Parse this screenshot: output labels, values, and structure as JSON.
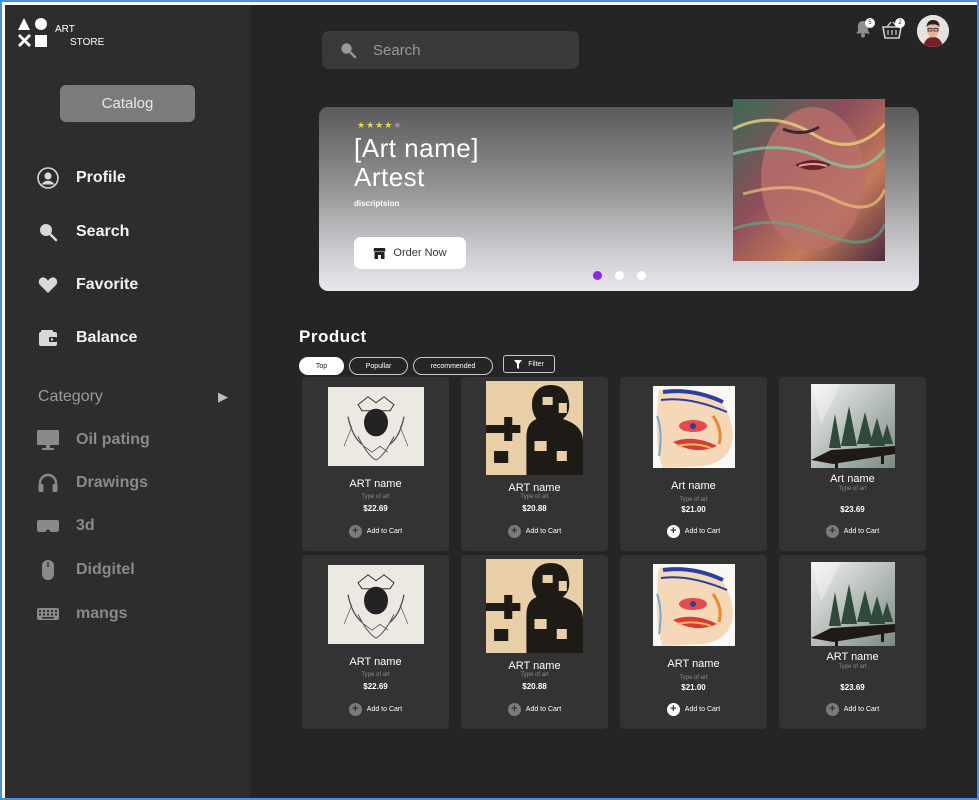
{
  "app": {
    "brand_line1": "ART",
    "brand_line2": "STORE"
  },
  "sidebar": {
    "catalog_label": "Catalog",
    "nav": [
      {
        "label": "Profile",
        "icon": "user-circle-icon"
      },
      {
        "label": "Search",
        "icon": "search-icon"
      },
      {
        "label": "Favorite",
        "icon": "heart-icon"
      },
      {
        "label": "Balance",
        "icon": "wallet-icon"
      }
    ],
    "category_label": "Category",
    "categories": [
      {
        "label": "Oil pating",
        "icon": "monitor-icon"
      },
      {
        "label": "Drawings",
        "icon": "headphones-icon"
      },
      {
        "label": "3d",
        "icon": "vr-goggles-icon"
      },
      {
        "label": "Didgitel",
        "icon": "mouse-icon"
      },
      {
        "label": "mangs",
        "icon": "keyboard-icon"
      }
    ]
  },
  "header": {
    "search_placeholder": "Search",
    "notifications_count": "5",
    "cart_count": "2"
  },
  "hero": {
    "rating": 4,
    "rating_max": 5,
    "title_line1": "[Art name]",
    "title_line2": "Artest",
    "description": "discriptsion",
    "order_label": "Order Now",
    "slides": 3,
    "active_slide": 0
  },
  "products": {
    "title": "Product",
    "filters": [
      "Top",
      "Popullar",
      "recommended"
    ],
    "active_filter": "Top",
    "filter_button": "Filter",
    "add_label": "Add to Cart",
    "items": [
      {
        "name": "ART name",
        "type": "Type of art",
        "price": "$22.69",
        "art": "sketch"
      },
      {
        "name": "ART name",
        "type": "Type of art",
        "price": "$20.88",
        "art": "puzzle"
      },
      {
        "name": "Art name",
        "type": "Type of art",
        "price": "$21.00",
        "art": "face"
      },
      {
        "name": "Art name",
        "type": "Type of art",
        "price": "$23.69",
        "art": "forest"
      },
      {
        "name": "ART name",
        "type": "Type of art",
        "price": "$22.69",
        "art": "sketch"
      },
      {
        "name": "ART name",
        "type": "Type of art",
        "price": "$20.88",
        "art": "puzzle"
      },
      {
        "name": "ART name",
        "type": "Type of art",
        "price": "$21.00",
        "art": "face"
      },
      {
        "name": "ART name",
        "type": "Type of art",
        "price": "$23.69",
        "art": "forest"
      }
    ]
  },
  "colors": {
    "accent": "#8a2be2",
    "star": "#e7d94a",
    "background": "#252525",
    "sidebar": "#2d2d2d",
    "card": "#333333"
  }
}
